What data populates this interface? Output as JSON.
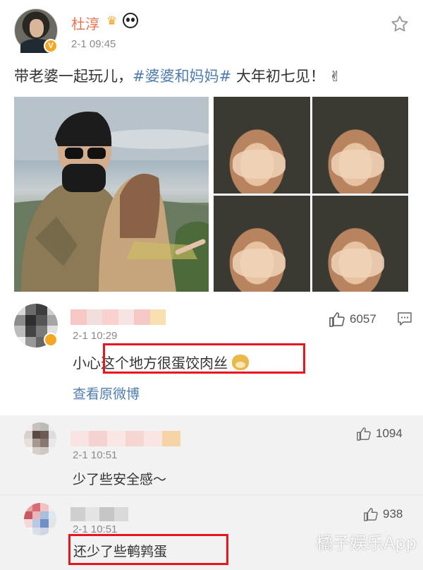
{
  "post": {
    "username": "杜淳",
    "time": "2-1 09:45",
    "text_before": "带老婆一起玩儿，",
    "hashtag": "#婆婆和妈妈#",
    "text_after": " 大年初七见！",
    "icons": [
      "verified-badge-icon",
      "crown-icon",
      "panda-icon",
      "star-icon",
      "victory-hand-icon"
    ],
    "verified_badge": "V"
  },
  "comments": [
    {
      "author": "",
      "time": "2-1 10:29",
      "text_before": "小心",
      "text_highlight": "这个地方很蛋饺肉丝",
      "likes": "6057",
      "view_original": "查看原微博"
    }
  ],
  "replies": [
    {
      "author": "",
      "time": "2-1 10:51",
      "text": "少了些安全感～",
      "likes": "1094"
    },
    {
      "author": "",
      "time": "2-1 10:51",
      "text": "还少了些鹌鹑蛋",
      "likes": "938"
    }
  ],
  "watermark": "橘子娱乐App",
  "colors": {
    "username": "#eb7350",
    "hashtag": "#507daf",
    "highlight_box": "#e8151f",
    "reply_bg": "#f2f2f2"
  }
}
